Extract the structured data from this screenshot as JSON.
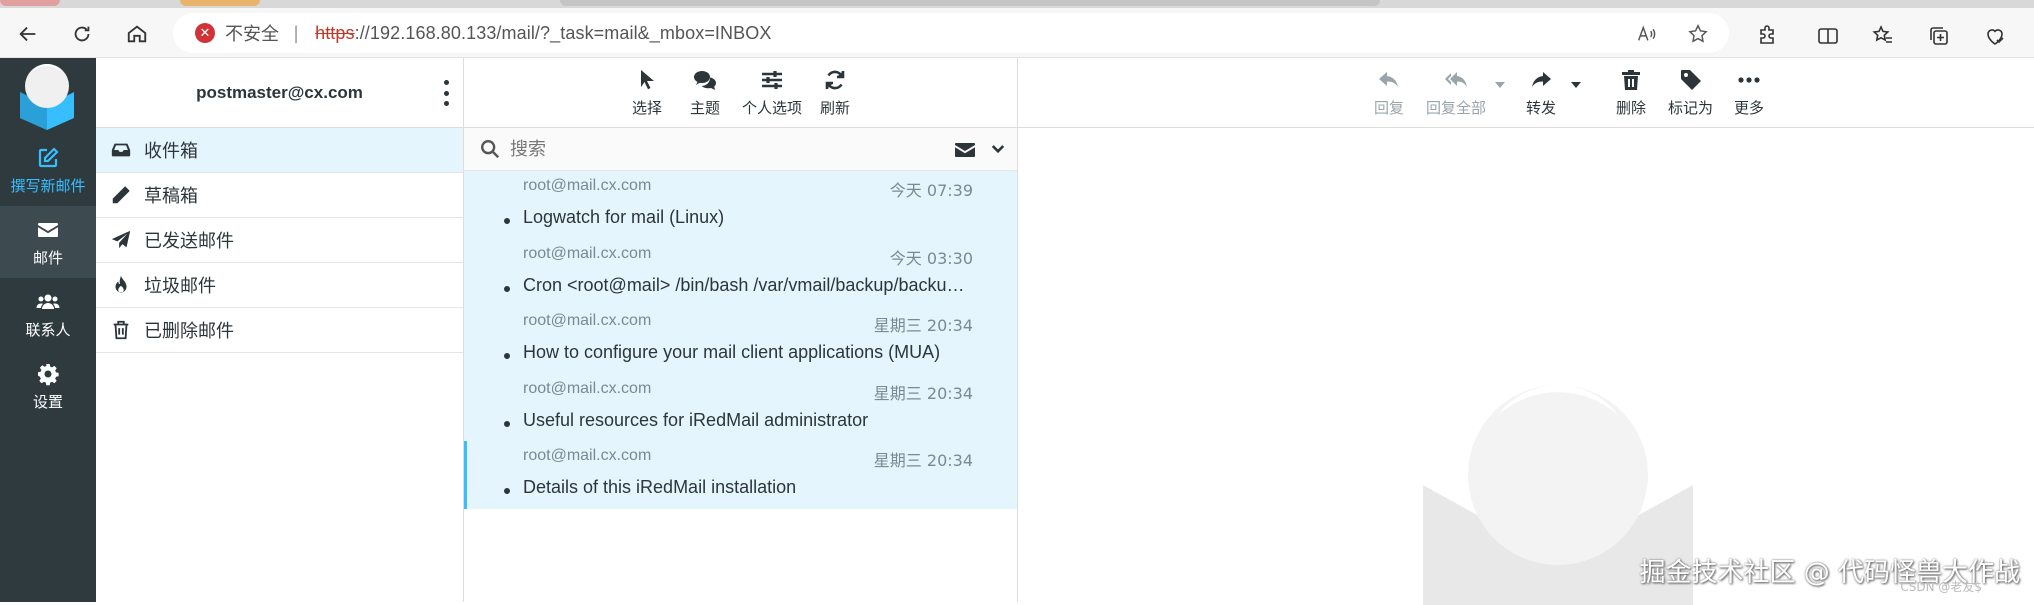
{
  "browser": {
    "insecure_label": "不安全",
    "separator": "|",
    "url_scheme": "https",
    "url_rest": "://192.168.80.133/mail/?_task=mail&_mbox=INBOX"
  },
  "sidebar": {
    "items": [
      {
        "label": "撰写新邮件",
        "icon": "compose-icon"
      },
      {
        "label": "邮件",
        "icon": "envelope-icon"
      },
      {
        "label": "联系人",
        "icon": "users-icon"
      },
      {
        "label": "设置",
        "icon": "gear-icon"
      }
    ]
  },
  "folders": {
    "account": "postmaster@cx.com",
    "items": [
      {
        "label": "收件箱",
        "icon": "inbox-icon"
      },
      {
        "label": "草稿箱",
        "icon": "pencil-icon"
      },
      {
        "label": "已发送邮件",
        "icon": "paper-plane-icon"
      },
      {
        "label": "垃圾邮件",
        "icon": "fire-icon"
      },
      {
        "label": "已删除邮件",
        "icon": "trash-icon"
      }
    ]
  },
  "list_toolbar": {
    "select": "选择",
    "threads": "主题",
    "options": "个人选项",
    "refresh": "刷新"
  },
  "search": {
    "placeholder": "搜索"
  },
  "messages": [
    {
      "from": "root@mail.cx.com",
      "date": "今天 07:39",
      "subject": "Logwatch for mail (Linux)"
    },
    {
      "from": "root@mail.cx.com",
      "date": "今天 03:30",
      "subject": "Cron <root@mail> /bin/bash /var/vmail/backup/backup_mysql.sh"
    },
    {
      "from": "root@mail.cx.com",
      "date": "星期三 20:34",
      "subject": "How to configure your mail client applications (MUA)"
    },
    {
      "from": "root@mail.cx.com",
      "date": "星期三 20:34",
      "subject": "Useful resources for iRedMail administrator"
    },
    {
      "from": "root@mail.cx.com",
      "date": "星期三 20:34",
      "subject": "Details of this iRedMail installation"
    }
  ],
  "preview_toolbar": {
    "reply": "回复",
    "reply_all": "回复全部",
    "forward": "转发",
    "delete": "删除",
    "mark": "标记为",
    "more": "更多"
  },
  "watermark": {
    "text": "掘金技术社区 @ 代码怪兽大作战",
    "small": "CSDN @老友$"
  },
  "colors": {
    "sidebar_bg": "#2f3a3f",
    "accent": "#37beff",
    "selected_bg": "#e5f5fd"
  }
}
